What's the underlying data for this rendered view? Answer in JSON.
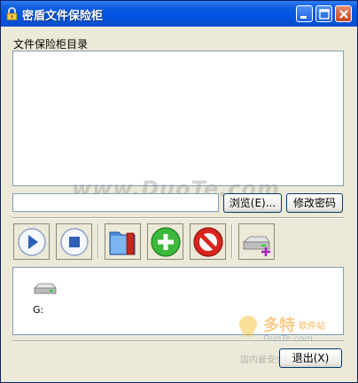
{
  "window": {
    "title": "密盾文件保险柜"
  },
  "content": {
    "directory_label": "文件保险柜目录",
    "path_value": "",
    "browse_label": "浏览(E)...",
    "change_password_label": "修改密码",
    "exit_label": "退出(X)"
  },
  "drives": {
    "items": [
      {
        "label": "G:",
        "icon": "drive-icon"
      }
    ]
  },
  "watermark": {
    "text": "www.DuoTe.com",
    "logo_main": "多特",
    "logo_sub": "软件站",
    "logo_url": "DuoTe.com",
    "logo_tagline": "国内最安全的软件站"
  },
  "colors": {
    "title_bar": "#0054E3",
    "face": "#ECE9D8",
    "field_border": "#7F9DB9"
  }
}
